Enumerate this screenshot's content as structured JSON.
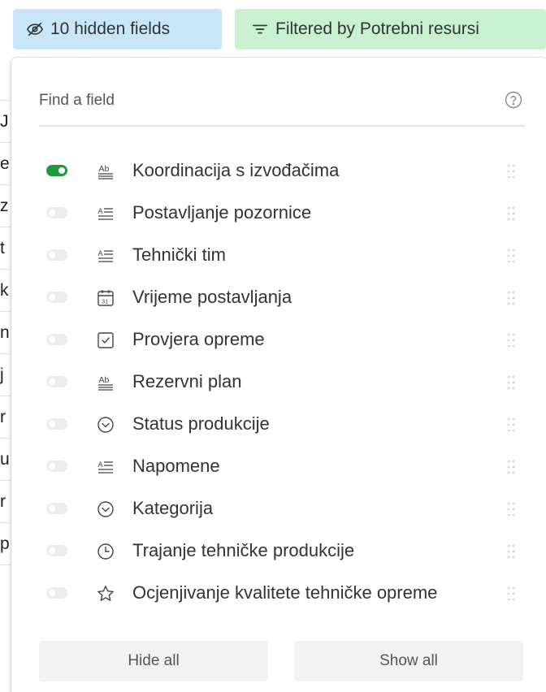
{
  "toolbar": {
    "hidden_fields_label": "10 hidden fields",
    "filter_label": "Filtered by Potrebni resursi",
    "hidden_icon": "eye-slash-icon",
    "filter_icon": "filter-lines-icon",
    "hidden_bg": "#c9e6f8",
    "filter_bg": "#c9f0cf"
  },
  "background_sheet": {
    "row_fragments": [
      "",
      "J",
      "e",
      "z",
      "t",
      "k",
      "n",
      "j",
      "r",
      "u",
      "r",
      "p"
    ]
  },
  "popup": {
    "search": {
      "placeholder": "Find a field",
      "value": "",
      "help_icon": "question-circle-icon"
    },
    "fields": [
      {
        "label": "Koordinacija s izvođačima",
        "icon": "long-text-icon",
        "visible": true
      },
      {
        "label": "Postavljanje pozornice",
        "icon": "rich-text-icon",
        "visible": false
      },
      {
        "label": "Tehnički tim",
        "icon": "rich-text-icon",
        "visible": false
      },
      {
        "label": "Vrijeme postavljanja",
        "icon": "calendar-icon",
        "visible": false
      },
      {
        "label": "Provjera opreme",
        "icon": "checkbox-icon",
        "visible": false
      },
      {
        "label": "Rezervni plan",
        "icon": "long-text-icon",
        "visible": false
      },
      {
        "label": "Status produkcije",
        "icon": "single-select-icon",
        "visible": false
      },
      {
        "label": "Napomene",
        "icon": "rich-text-icon",
        "visible": false
      },
      {
        "label": "Kategorija",
        "icon": "single-select-icon",
        "visible": false
      },
      {
        "label": "Trajanje tehničke produkcije",
        "icon": "clock-icon",
        "visible": false
      },
      {
        "label": "Ocjenjivanje kvalitete tehničke opreme",
        "icon": "star-icon",
        "visible": false
      }
    ],
    "hide_all_label": "Hide all",
    "show_all_label": "Show all"
  },
  "colors": {
    "toggle_on": "#1f9a3a",
    "toggle_off": "#ececec"
  }
}
